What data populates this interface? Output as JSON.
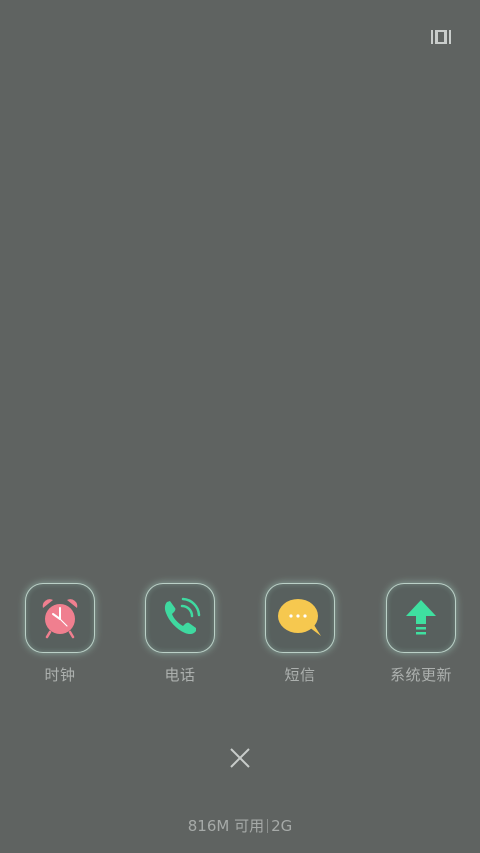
{
  "top_bar": {
    "icon": "recent-apps-grid-icon"
  },
  "apps": [
    {
      "label": "时钟",
      "icon": "alarm-clock-icon",
      "color": "#f07f8f"
    },
    {
      "label": "电话",
      "icon": "phone-icon",
      "color": "#3fd9a0"
    },
    {
      "label": "短信",
      "icon": "message-bubble-icon",
      "color": "#f6c84f"
    },
    {
      "label": "系统更新",
      "icon": "update-arrow-icon",
      "color": "#3fe0a0"
    }
  ],
  "close": {
    "icon": "close-icon"
  },
  "memory": {
    "available": "816M 可用",
    "total": "2G"
  }
}
